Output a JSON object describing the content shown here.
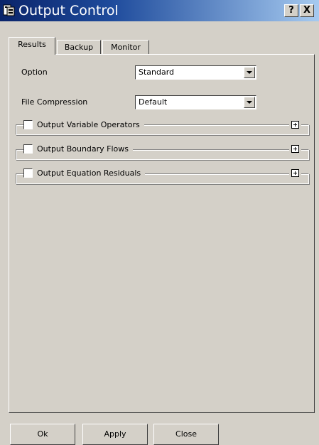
{
  "window": {
    "title": "Output Control",
    "icon": "output-control-icon",
    "help_label": "?",
    "close_label": "X"
  },
  "tabs": [
    {
      "label": "Results",
      "active": true
    },
    {
      "label": "Backup",
      "active": false
    },
    {
      "label": "Monitor",
      "active": false
    }
  ],
  "results": {
    "option": {
      "label": "Option",
      "value": "Standard"
    },
    "file_compression": {
      "label": "File Compression",
      "value": "Default"
    },
    "groups": [
      {
        "label": "Output Variable Operators",
        "checked": false,
        "expanded": false
      },
      {
        "label": "Output Boundary Flows",
        "checked": false,
        "expanded": false
      },
      {
        "label": "Output Equation Residuals",
        "checked": false,
        "expanded": false
      }
    ]
  },
  "buttons": {
    "ok": "Ok",
    "apply": "Apply",
    "close": "Close"
  },
  "colors": {
    "title_gradient_start": "#0a246a",
    "title_gradient_end": "#a6caf0",
    "face": "#d4d0c8"
  }
}
